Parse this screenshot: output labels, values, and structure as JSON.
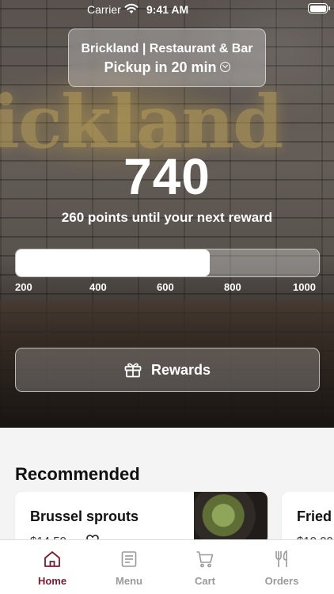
{
  "status_bar": {
    "carrier": "Carrier",
    "time": "9:41 AM"
  },
  "hero": {
    "sign_text": "ickland"
  },
  "store": {
    "name": "Brickland | Restaurant & Bar",
    "pickup": "Pickup in 20 min"
  },
  "rewards": {
    "points": "740",
    "points_message": "260 points until your next reward",
    "progress_fraction": 0.64,
    "ticks": [
      "200",
      "400",
      "600",
      "800",
      "1000"
    ],
    "button_label": "Rewards"
  },
  "recommended": {
    "title": "Recommended",
    "items": [
      {
        "name": "Brussel sprouts",
        "price": "$14.50"
      },
      {
        "name": "Fried",
        "price": "$10.00"
      }
    ]
  },
  "tabs": [
    {
      "label": "Home",
      "icon": "home-icon",
      "active": true
    },
    {
      "label": "Menu",
      "icon": "menu-icon",
      "active": false
    },
    {
      "label": "Cart",
      "icon": "cart-icon",
      "active": false
    },
    {
      "label": "Orders",
      "icon": "orders-icon",
      "active": false
    }
  ],
  "colors": {
    "accent": "#7c1a2e",
    "inactive_tab": "#9a9a9a"
  }
}
